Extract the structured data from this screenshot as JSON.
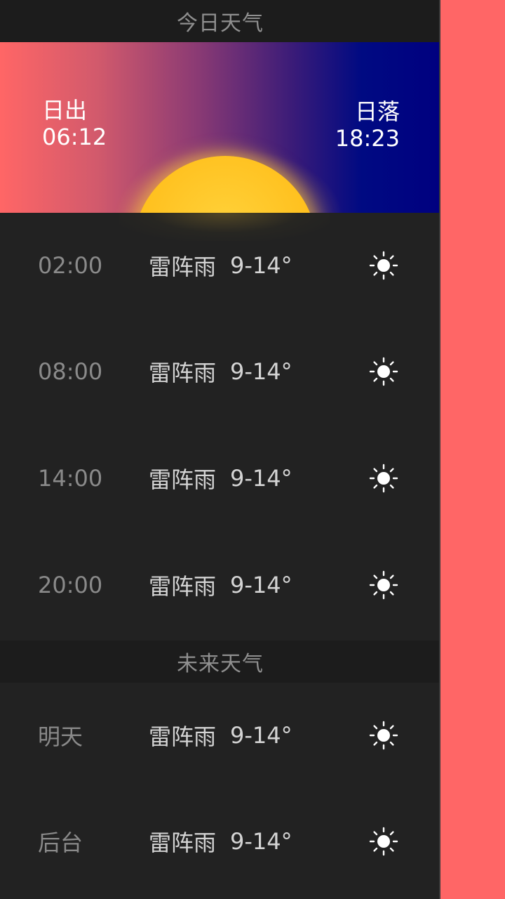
{
  "today_header": "今日天气",
  "sun": {
    "sunrise_label": "日出",
    "sunrise_time": "06:12",
    "sunset_label": "日落",
    "sunset_time": "18:23"
  },
  "today_rows": [
    {
      "time": "02:00",
      "condition": "雷阵雨",
      "temp": "9-14°",
      "icon": "sun-icon"
    },
    {
      "time": "08:00",
      "condition": "雷阵雨",
      "temp": "9-14°",
      "icon": "sun-icon"
    },
    {
      "time": "14:00",
      "condition": "雷阵雨",
      "temp": "9-14°",
      "icon": "sun-icon"
    },
    {
      "time": "20:00",
      "condition": "雷阵雨",
      "temp": "9-14°",
      "icon": "sun-icon"
    }
  ],
  "future_header": "未来天气",
  "future_rows": [
    {
      "day": "明天",
      "condition": "雷阵雨",
      "temp": "9-14°",
      "icon": "sun-icon"
    },
    {
      "day": "后台",
      "condition": "雷阵雨",
      "temp": "9-14°",
      "icon": "sun-icon"
    }
  ],
  "colors": {
    "side_background": "#ff6666",
    "panel_background": "#222222",
    "sun": "#ffc01e",
    "gradient_start": "#ff6666",
    "gradient_end": "#000080"
  }
}
